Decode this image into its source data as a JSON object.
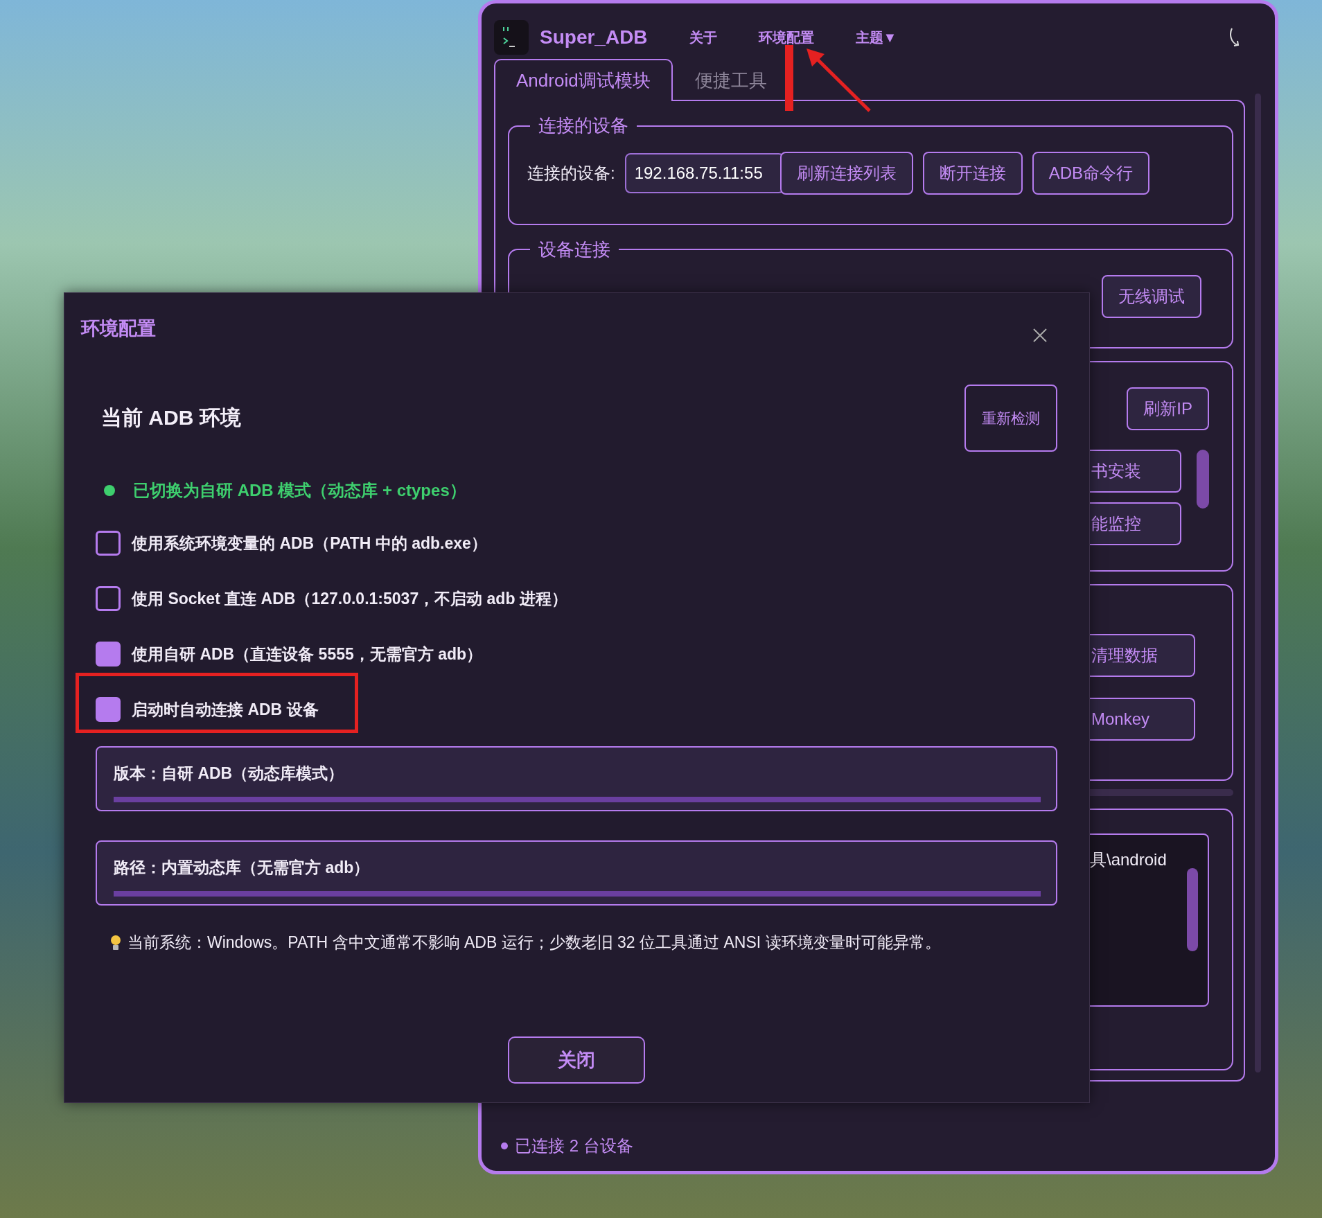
{
  "main_window": {
    "title": "Super_ADB",
    "menu": [
      "关于",
      "环境配置",
      "主题▼"
    ],
    "tabs": [
      {
        "label": "Android调试模块",
        "selected": true
      },
      {
        "label": "便捷工具",
        "selected": false
      }
    ],
    "connected_devices": {
      "legend": "连接的设备",
      "label": "连接的设备:",
      "value": "192.168.75.11:55",
      "buttons": [
        "刷新连接列表",
        "断开连接",
        "ADB命令行"
      ]
    },
    "device_connection": {
      "legend": "设备连接",
      "buttons": [
        "无线调试"
      ]
    },
    "group_3": {
      "buttons": [
        "刷新IP"
      ],
      "list_buttons": [
        "书安装",
        "能监控"
      ]
    },
    "group_4": {
      "buttons": [
        "清理数据",
        "Monkey"
      ]
    },
    "group_5": {
      "console_text": "具\\android"
    },
    "status_bar": "已连接 2 台设备"
  },
  "dialog": {
    "title": "环境配置",
    "heading": "当前 ADB 环境",
    "recheck_button": "重新检测",
    "status": "已切换为自研 ADB 模式（动态库 + ctypes）",
    "options": [
      {
        "label": "使用系统环境变量的 ADB（PATH 中的 adb.exe）",
        "checked": false
      },
      {
        "label": "使用 Socket 直连 ADB（127.0.0.1:5037，不启动 adb 进程）",
        "checked": false
      },
      {
        "label": "使用自研 ADB（直连设备 5555，无需官方 adb）",
        "checked": true
      },
      {
        "label": "启动时自动连接 ADB 设备",
        "checked": true
      }
    ],
    "info": [
      "版本：自研 ADB（动态库模式）",
      "路径：内置动态库（无需官方 adb）"
    ],
    "hint": "当前系统：Windows。PATH 含中文通常不影响 ADB 运行；少数老旧 32 位工具通过 ANSI 读环境变量时可能异常。",
    "close_button": "关闭"
  }
}
